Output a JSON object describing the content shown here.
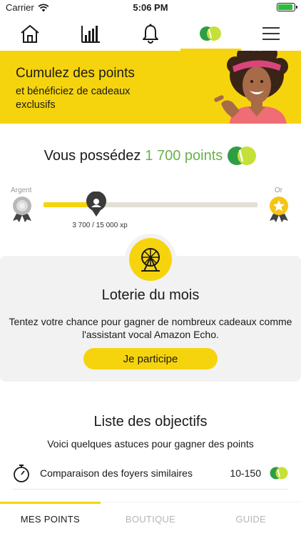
{
  "status_bar": {
    "carrier": "Carrier",
    "time": "5:06 PM"
  },
  "top_nav": {
    "items": [
      {
        "icon": "home-icon",
        "active": false
      },
      {
        "icon": "chart-icon",
        "active": false
      },
      {
        "icon": "bell-icon",
        "active": false
      },
      {
        "icon": "points-logo-icon",
        "active": true
      },
      {
        "icon": "menu-icon",
        "active": false
      }
    ]
  },
  "banner": {
    "title": "Cumulez des points",
    "subtitle": "et bénéficiez de cadeaux exclusifs"
  },
  "points": {
    "prefix": "Vous possédez",
    "value": "1 700 points",
    "color": "#6ab04c"
  },
  "progress": {
    "start_label": "Argent",
    "end_label": "Or",
    "text": "3 700 / 15 000 xp",
    "fraction": 0.247
  },
  "lottery": {
    "title": "Loterie du mois",
    "description": "Tentez votre chance pour gagner de nombreux cadeaux comme l'assistant vocal Amazon Echo.",
    "button_label": "Je participe"
  },
  "objectives": {
    "title": "Liste des objectifs",
    "subtitle": "Voici quelques astuces pour gagner des points",
    "items": [
      {
        "label": "Comparaison des foyers similaires",
        "range": "10-150"
      }
    ]
  },
  "bottom_tabs": {
    "items": [
      {
        "label": "MES POINTS",
        "active": true
      },
      {
        "label": "BOUTIQUE",
        "active": false
      },
      {
        "label": "GUIDE",
        "active": false
      }
    ]
  },
  "colors": {
    "accent": "#f6d40d",
    "points_green": "#6ab04c"
  }
}
